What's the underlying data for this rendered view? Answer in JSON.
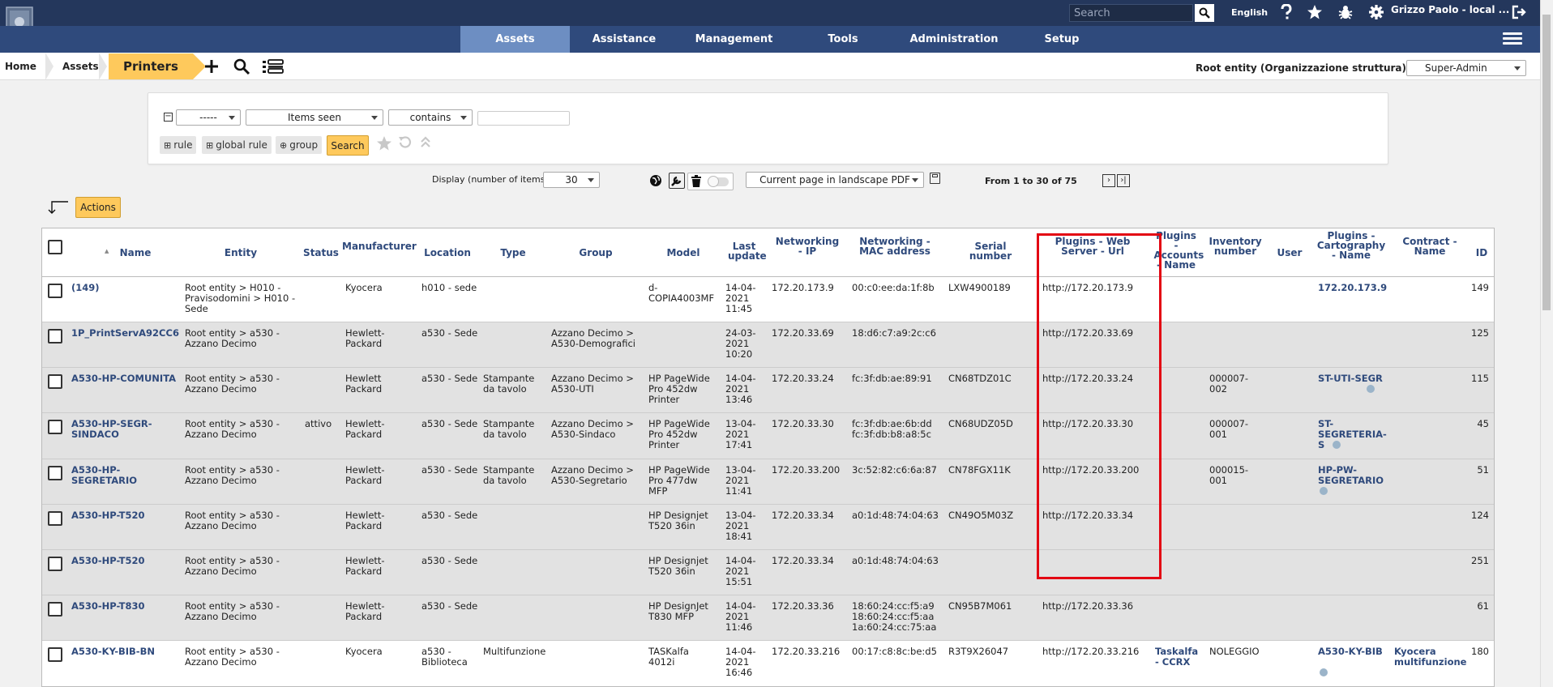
{
  "header": {
    "search_placeholder": "Search",
    "language": "English",
    "user": "Grizzo Paolo - local ...",
    "icons": [
      "help-icon",
      "star-icon",
      "bug-icon",
      "gear-icon",
      "logout-icon"
    ]
  },
  "nav": {
    "tabs": [
      "Assets",
      "Assistance",
      "Management",
      "Tools",
      "Administration",
      "Setup"
    ],
    "active": "Assets"
  },
  "breadcrumb": {
    "home": "Home",
    "assets": "Assets",
    "printers": "Printers"
  },
  "entity": "Root entity (Organizzazione struttura)",
  "profile": "Super-Admin",
  "search": {
    "criteria_field": "-----",
    "criteria_items": "Items seen",
    "criteria_op": "contains",
    "criteria_value": "",
    "rule_btn": "rule",
    "global_rule_btn": "global rule",
    "group_btn": "group",
    "search_btn": "Search"
  },
  "display": {
    "label": "Display (number of items)",
    "value": "30",
    "export": "Current page in landscape PDF",
    "pager": "From 1 to 30 of 75"
  },
  "actions": "Actions",
  "columns": [
    "Name",
    "Entity",
    "Status",
    "Manufacturer",
    "Location",
    "Type",
    "Group",
    "Model",
    "Last update",
    "Networking - IP",
    "Networking - MAC address",
    "Serial number",
    "Plugins - Web Server - Url",
    "Plugins - Accounts - Name",
    "Inventory number",
    "User",
    "Plugins - Cartography - Name",
    "Contract - Name",
    "ID"
  ],
  "rows": [
    {
      "name": "(149)",
      "entity": "Root entity > H010 - Pravisodomini > H010 - Sede",
      "status": "",
      "manufacturer": "Kyocera",
      "location": "h010 - sede",
      "type": "",
      "group": "",
      "model": "d-COPIA4003MF",
      "updated": "14-04-2021 11:45",
      "ip": "172.20.173.9",
      "mac": "00:c0:ee:da:1f:8b",
      "serial": "LXW4900189",
      "url": "http://172.20.173.9",
      "accounts": "",
      "inventory": "",
      "user": "",
      "carto": "172.20.173.9",
      "contract": "",
      "id": "149"
    },
    {
      "name": "1P_PrintServA92CC6",
      "entity": "Root entity > a530 - Azzano Decimo",
      "status": "",
      "manufacturer": "Hewlett-Packard",
      "location": "a530 - Sede",
      "type": "",
      "group": "Azzano Decimo > A530-Demografici",
      "model": "",
      "updated": "24-03-2021 10:20",
      "ip": "172.20.33.69",
      "mac": "18:d6:c7:a9:2c:c6",
      "serial": "",
      "url": "http://172.20.33.69",
      "accounts": "",
      "inventory": "",
      "user": "",
      "carto": "",
      "contract": "",
      "id": "125"
    },
    {
      "name": "A530-HP-COMUNITA",
      "entity": "Root entity > a530 - Azzano Decimo",
      "status": "",
      "manufacturer": "Hewlett Packard",
      "location": "a530 - Sede",
      "type": "Stampante da tavolo",
      "group": "Azzano Decimo > A530-UTI",
      "model": "HP PageWide Pro 452dw Printer",
      "updated": "14-04-2021 13:46",
      "ip": "172.20.33.24",
      "mac": "fc:3f:db:ae:89:91",
      "serial": "CN68TDZ01C",
      "url": "http://172.20.33.24",
      "accounts": "",
      "inventory": "000007-002",
      "user": "",
      "carto": "ST-UTI-SEGR",
      "contract": "",
      "id": "115"
    },
    {
      "name": "A530-HP-SEGR-SINDACO",
      "entity": "Root entity > a530 - Azzano Decimo",
      "status": "attivo",
      "manufacturer": "Hewlett-Packard",
      "location": "a530 - Sede",
      "type": "Stampante da tavolo",
      "group": "Azzano Decimo > A530-Sindaco",
      "model": "HP PageWide Pro 452dw Printer",
      "updated": "13-04-2021 17:41",
      "ip": "172.20.33.30",
      "mac": "fc:3f:db:ae:6b:dd fc:3f:db:b8:a8:5c",
      "serial": "CN68UDZ05D",
      "url": "http://172.20.33.30",
      "accounts": "",
      "inventory": "000007-001",
      "user": "",
      "carto": "ST-SEGRETERIA-S",
      "contract": "",
      "id": "45"
    },
    {
      "name": "A530-HP-SEGRETARIO",
      "entity": "Root entity > a530 - Azzano Decimo",
      "status": "",
      "manufacturer": "Hewlett-Packard",
      "location": "a530 - Sede",
      "type": "Stampante da tavolo",
      "group": "Azzano Decimo > A530-Segretario",
      "model": "HP PageWide Pro 477dw MFP",
      "updated": "13-04-2021 11:41",
      "ip": "172.20.33.200",
      "mac": "3c:52:82:c6:6a:87",
      "serial": "CN78FGX11K",
      "url": "http://172.20.33.200",
      "accounts": "",
      "inventory": "000015-001",
      "user": "",
      "carto": "HP-PW-SEGRETARIO",
      "contract": "",
      "id": "51"
    },
    {
      "name": "A530-HP-T520",
      "entity": "Root entity > a530 - Azzano Decimo",
      "status": "",
      "manufacturer": "Hewlett-Packard",
      "location": "a530 - Sede",
      "type": "",
      "group": "",
      "model": "HP Designjet T520 36in",
      "updated": "13-04-2021 18:41",
      "ip": "172.20.33.34",
      "mac": "a0:1d:48:74:04:63",
      "serial": "CN49O5M03Z",
      "url": "http://172.20.33.34",
      "accounts": "",
      "inventory": "",
      "user": "",
      "carto": "",
      "contract": "",
      "id": "124"
    },
    {
      "name": "A530-HP-T520",
      "entity": "Root entity > a530 - Azzano Decimo",
      "status": "",
      "manufacturer": "Hewlett-Packard",
      "location": "a530 - Sede",
      "type": "",
      "group": "",
      "model": "HP Designjet T520 36in",
      "updated": "14-04-2021 15:51",
      "ip": "172.20.33.34",
      "mac": "a0:1d:48:74:04:63",
      "serial": "",
      "url": "",
      "accounts": "",
      "inventory": "",
      "user": "",
      "carto": "",
      "contract": "",
      "id": "251"
    },
    {
      "name": "A530-HP-T830",
      "entity": "Root entity > a530 - Azzano Decimo",
      "status": "",
      "manufacturer": "Hewlett-Packard",
      "location": "a530 - Sede",
      "type": "",
      "group": "",
      "model": "HP DesignJet T830 MFP",
      "updated": "14-04-2021 11:46",
      "ip": "172.20.33.36",
      "mac": "18:60:24:cc:f5:a9 18:60:24:cc:f5:aa 1a:60:24:cc:75:aa",
      "serial": "CN95B7M061",
      "url": "http://172.20.33.36",
      "accounts": "",
      "inventory": "",
      "user": "",
      "carto": "",
      "contract": "",
      "id": "61"
    },
    {
      "name": "A530-KY-BIB-BN",
      "entity": "Root entity > a530 - Azzano Decimo",
      "status": "",
      "manufacturer": "Kyocera",
      "location": "a530 - Biblioteca",
      "type": "Multifunzione",
      "group": "",
      "model": "TASKalfa 4012i",
      "updated": "14-04-2021 16:46",
      "ip": "172.20.33.216",
      "mac": "00:17:c8:8c:be:d5",
      "serial": "R3T9X26047",
      "url": "http://172.20.33.216",
      "accounts": "Taskalfa - CCRX",
      "inventory": "NOLEGGIO",
      "user": "",
      "carto": "A530-KY-BIB",
      "contract": "Kyocera multifunzione",
      "id": "180"
    }
  ]
}
